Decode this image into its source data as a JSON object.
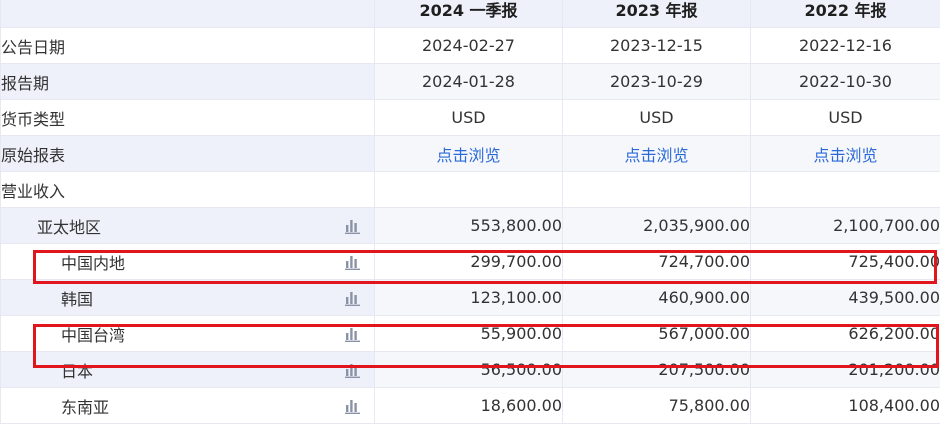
{
  "columns": {
    "label": "",
    "periods": [
      "2024 一季报",
      "2023 年报",
      "2022 年报"
    ]
  },
  "meta_rows": [
    {
      "label": "公告日期",
      "values": [
        "2024-02-27",
        "2023-12-15",
        "2022-12-16"
      ]
    },
    {
      "label": "报告期",
      "values": [
        "2024-01-28",
        "2023-10-29",
        "2022-10-30"
      ]
    },
    {
      "label": "货币类型",
      "values": [
        "USD",
        "USD",
        "USD"
      ]
    },
    {
      "label": "原始报表",
      "values": [
        "点击浏览",
        "点击浏览",
        "点击浏览"
      ]
    }
  ],
  "section": {
    "label": "营业收入"
  },
  "region_rows": [
    {
      "label": "亚太地区",
      "level": 1,
      "values": [
        "553,800.00",
        "2,035,900.00",
        "2,100,700.00"
      ],
      "highlighted": false
    },
    {
      "label": "中国内地",
      "level": 2,
      "values": [
        "299,700.00",
        "724,700.00",
        "725,400.00"
      ],
      "highlighted": true
    },
    {
      "label": "韩国",
      "level": 2,
      "values": [
        "123,100.00",
        "460,900.00",
        "439,500.00"
      ],
      "highlighted": false
    },
    {
      "label": "中国台湾",
      "level": 2,
      "values": [
        "55,900.00",
        "567,000.00",
        "626,200.00"
      ],
      "highlighted": true
    },
    {
      "label": "日本",
      "level": 2,
      "values": [
        "56,500.00",
        "207,500.00",
        "201,200.00"
      ],
      "highlighted": false
    },
    {
      "label": "东南亚",
      "level": 2,
      "values": [
        "18,600.00",
        "75,800.00",
        "108,400.00"
      ],
      "highlighted": false
    }
  ],
  "colors": {
    "link": "#2a6ad8",
    "highlight_border": "#e0161c",
    "header_bg": "#eef1f9",
    "icon": "#8a93a6"
  },
  "icons": {
    "row_chart": "bar-chart-icon"
  }
}
